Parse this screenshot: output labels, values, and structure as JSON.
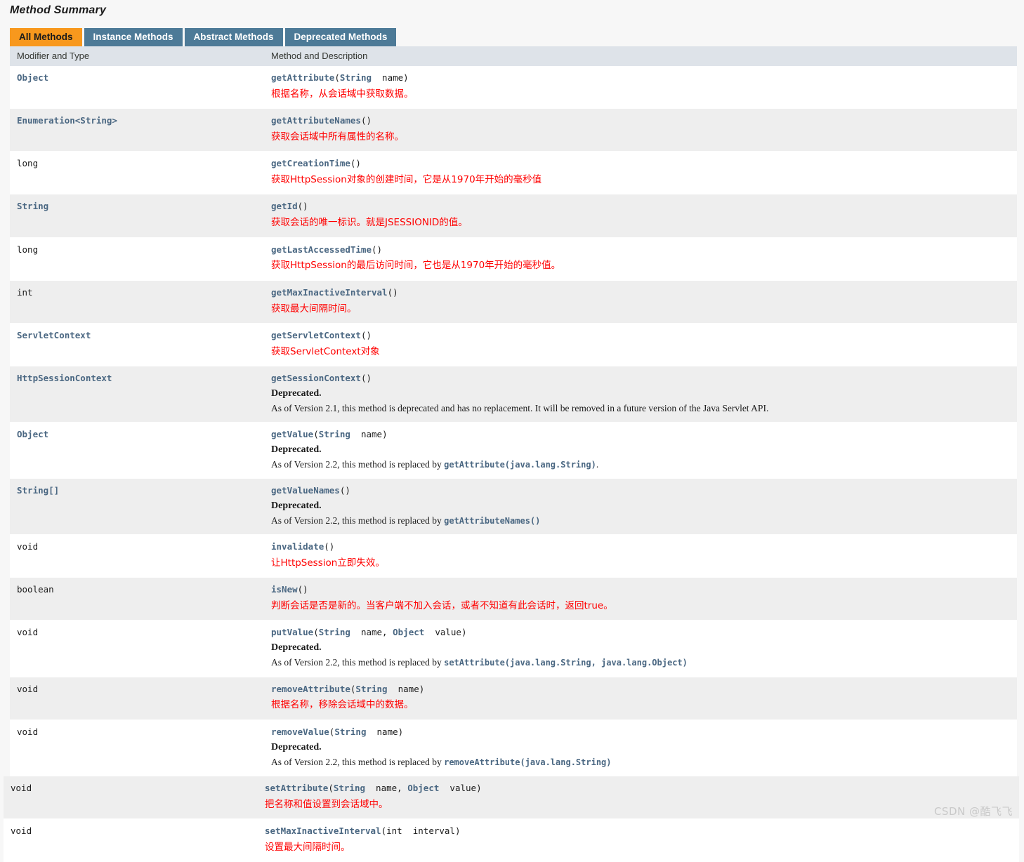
{
  "page": {
    "title": "Method Summary",
    "watermark": "CSDN @酷飞飞"
  },
  "tabs": [
    {
      "label": "All Methods",
      "state": "active"
    },
    {
      "label": "Instance Methods",
      "state": "inactive"
    },
    {
      "label": "Abstract Methods",
      "state": "inactive"
    },
    {
      "label": "Deprecated Methods",
      "state": "inactive"
    }
  ],
  "columns": {
    "type": "Modifier and Type",
    "description": "Method and Description"
  },
  "colors": {
    "tab_active_bg": "#f8981d",
    "tab_inactive_bg": "#4d7a97",
    "header_bg": "#dee3e9",
    "row_alt_bg": "#eeeeee",
    "link": "#4a6782",
    "annotation": "#ff0000",
    "page_bg": "#f7f7f7"
  },
  "rows": [
    {
      "type": "Object",
      "type_link": true,
      "method": "getAttribute",
      "signature_open": "(",
      "params": [
        {
          "text": "String",
          "link": true
        },
        {
          "text": "  name",
          "link": false
        }
      ],
      "signature_close": ")",
      "note": "根据名称，从会话域中获取数据。",
      "deprecated": null,
      "shade": "norm"
    },
    {
      "type": "Enumeration<String>",
      "type_link": true,
      "method": "getAttributeNames",
      "signature_open": "(",
      "params": [],
      "signature_close": ")",
      "note": "获取会话域中所有属性的名称。",
      "deprecated": null,
      "shade": "alt"
    },
    {
      "type": "long",
      "type_link": false,
      "method": "getCreationTime",
      "signature_open": "(",
      "params": [],
      "signature_close": ")",
      "note": "获取HttpSession对象的创建时间，它是从1970年开始的毫秒值",
      "deprecated": null,
      "shade": "norm"
    },
    {
      "type": "String",
      "type_link": true,
      "method": "getId",
      "signature_open": "(",
      "params": [],
      "signature_close": ")",
      "note": "获取会话的唯一标识。就是JSESSIONID的值。",
      "deprecated": null,
      "shade": "alt"
    },
    {
      "type": "long",
      "type_link": false,
      "method": "getLastAccessedTime",
      "signature_open": "(",
      "params": [],
      "signature_close": ")",
      "note": "获取HttpSession的最后访问时间，它也是从1970年开始的毫秒值。",
      "deprecated": null,
      "shade": "norm"
    },
    {
      "type": "int",
      "type_link": false,
      "method": "getMaxInactiveInterval",
      "signature_open": "(",
      "params": [],
      "signature_close": ")",
      "note": "获取最大间隔时间。",
      "deprecated": null,
      "shade": "alt"
    },
    {
      "type": "ServletContext",
      "type_link": true,
      "method": "getServletContext",
      "signature_open": "(",
      "params": [],
      "signature_close": ")",
      "note": "获取ServletContext对象",
      "deprecated": null,
      "shade": "norm"
    },
    {
      "type": "HttpSessionContext",
      "type_link": true,
      "method": "getSessionContext",
      "signature_open": "(",
      "params": [],
      "signature_close": ")",
      "note": null,
      "deprecated": {
        "label": "Deprecated.",
        "body_prefix": "As of Version 2.1, this method is deprecated and has no replacement. It will be removed in a future version of the Java Servlet API.",
        "body_code": "",
        "body_suffix": ""
      },
      "shade": "alt"
    },
    {
      "type": "Object",
      "type_link": true,
      "method": "getValue",
      "signature_open": "(",
      "params": [
        {
          "text": "String",
          "link": true
        },
        {
          "text": "  name",
          "link": false
        }
      ],
      "signature_close": ")",
      "note": null,
      "deprecated": {
        "label": "Deprecated.",
        "body_prefix": "As of Version 2.2, this method is replaced by ",
        "body_code": "getAttribute(java.lang.String)",
        "body_suffix": "."
      },
      "shade": "norm"
    },
    {
      "type": "String[]",
      "type_link": true,
      "method": "getValueNames",
      "signature_open": "(",
      "params": [],
      "signature_close": ")",
      "note": null,
      "deprecated": {
        "label": "Deprecated.",
        "body_prefix": "As of Version 2.2, this method is replaced by ",
        "body_code": "getAttributeNames()",
        "body_suffix": ""
      },
      "shade": "alt"
    },
    {
      "type": "void",
      "type_link": false,
      "method": "invalidate",
      "signature_open": "(",
      "params": [],
      "signature_close": ")",
      "note": "让HttpSession立即失效。",
      "deprecated": null,
      "shade": "norm"
    },
    {
      "type": "boolean",
      "type_link": false,
      "method": "isNew",
      "signature_open": "(",
      "params": [],
      "signature_close": ")",
      "note": "判断会话是否是新的。当客户端不加入会话，或者不知道有此会话时，返回true。",
      "deprecated": null,
      "shade": "alt"
    },
    {
      "type": "void",
      "type_link": false,
      "method": "putValue",
      "signature_open": "(",
      "params": [
        {
          "text": "String",
          "link": true
        },
        {
          "text": "  name, ",
          "link": false
        },
        {
          "text": "Object",
          "link": true
        },
        {
          "text": "  value",
          "link": false
        }
      ],
      "signature_close": ")",
      "note": null,
      "deprecated": {
        "label": "Deprecated.",
        "body_prefix": "As of Version 2.2, this method is replaced by ",
        "body_code": "setAttribute(java.lang.String,  java.lang.Object)",
        "body_suffix": ""
      },
      "shade": "norm"
    },
    {
      "type": "void",
      "type_link": false,
      "method": "removeAttribute",
      "signature_open": "(",
      "params": [
        {
          "text": "String",
          "link": true
        },
        {
          "text": "  name",
          "link": false
        }
      ],
      "signature_close": ")",
      "note": "根据名称，移除会话域中的数据。",
      "deprecated": null,
      "shade": "alt"
    },
    {
      "type": "void",
      "type_link": false,
      "method": "removeValue",
      "signature_open": "(",
      "params": [
        {
          "text": "String",
          "link": true
        },
        {
          "text": "  name",
          "link": false
        }
      ],
      "signature_close": ")",
      "note": null,
      "deprecated": {
        "label": "Deprecated.",
        "body_prefix": "As of Version 2.2, this method is replaced by ",
        "body_code": "removeAttribute(java.lang.String)",
        "body_suffix": ""
      },
      "shade": "norm"
    }
  ],
  "tail_rows": [
    {
      "type": "void",
      "type_link": false,
      "method": "setAttribute",
      "signature_open": "(",
      "params": [
        {
          "text": "String",
          "link": true
        },
        {
          "text": "  name, ",
          "link": false
        },
        {
          "text": "Object",
          "link": true
        },
        {
          "text": "  value",
          "link": false
        }
      ],
      "signature_close": ")",
      "note": "把名称和值设置到会话域中。",
      "deprecated": null,
      "shade": "alt"
    },
    {
      "type": "void",
      "type_link": false,
      "method": "setMaxInactiveInterval",
      "signature_open": "(",
      "params": [
        {
          "text": "int",
          "link": false
        },
        {
          "text": "  interval",
          "link": false
        }
      ],
      "signature_close": ")",
      "note": "设置最大间隔时间。",
      "deprecated": null,
      "shade": "norm"
    }
  ]
}
